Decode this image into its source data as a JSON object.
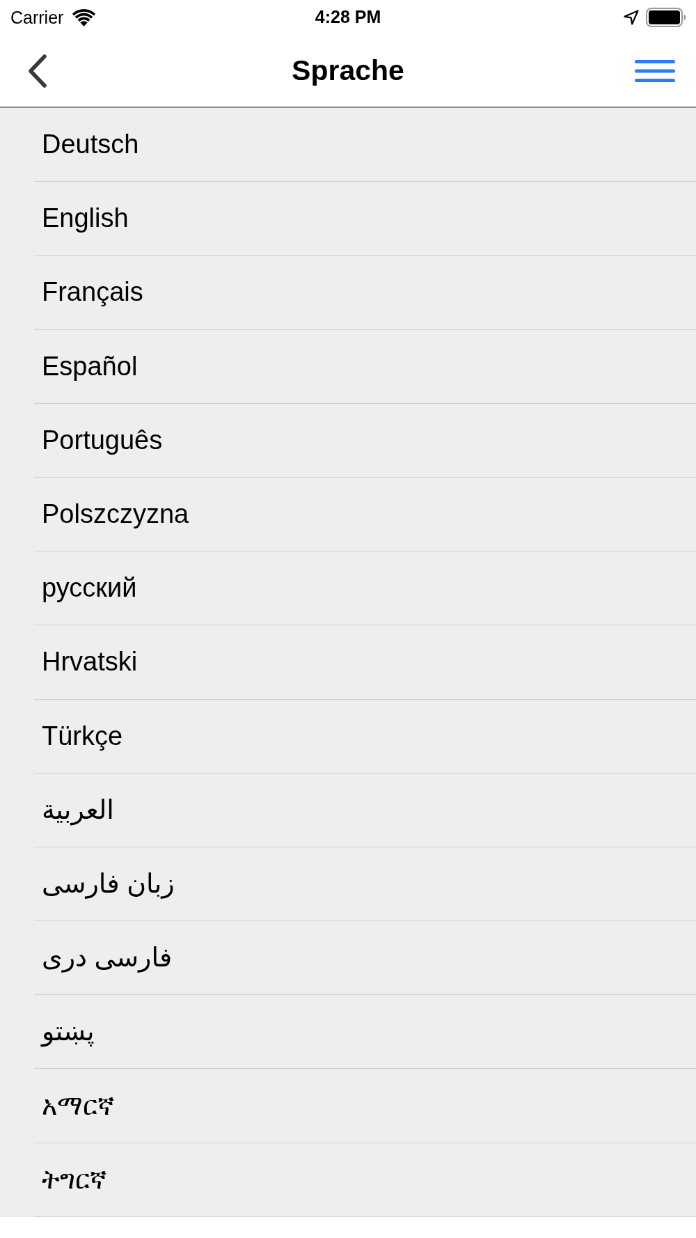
{
  "status_bar": {
    "carrier": "Carrier",
    "time": "4:28 PM"
  },
  "nav_bar": {
    "title": "Sprache"
  },
  "languages": [
    {
      "label": "Deutsch"
    },
    {
      "label": "English"
    },
    {
      "label": "Français"
    },
    {
      "label": "Español"
    },
    {
      "label": "Português"
    },
    {
      "label": "Polszczyzna"
    },
    {
      "label": "русский"
    },
    {
      "label": "Hrvatski"
    },
    {
      "label": "Türkçe"
    },
    {
      "label": "العربية"
    },
    {
      "label": "زبان فارسی"
    },
    {
      "label": "فارسی دری"
    },
    {
      "label": "پښتو"
    },
    {
      "label": "አማርኛ"
    },
    {
      "label": "ትግርኛ"
    }
  ]
}
